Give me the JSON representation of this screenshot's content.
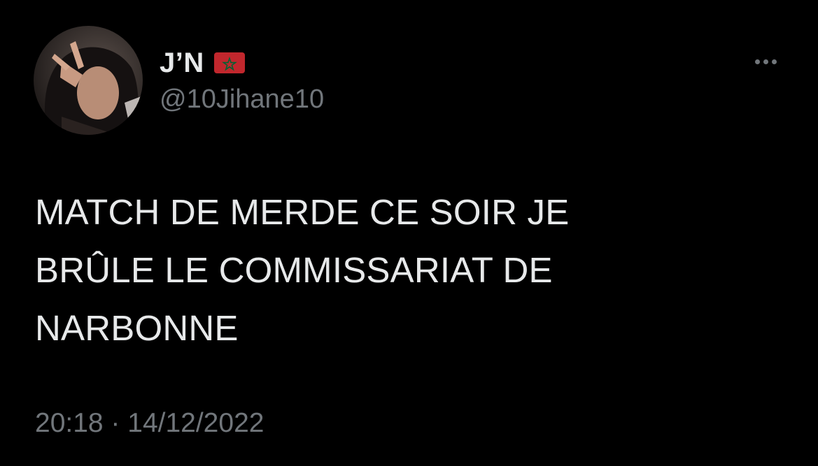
{
  "tweet": {
    "author": {
      "display_name": "J’N",
      "flag_icon": "morocco-flag-icon",
      "handle": "@10Jihane10"
    },
    "text": "MATCH DE MERDE CE SOIR JE\nBRÛLE LE COMMISSARIAT DE\nNARBONNE",
    "timestamp": "20:18 · 14/12/2022",
    "more_icon": "more-options-icon"
  },
  "colors": {
    "background": "#000000",
    "primary_text": "#e7e9ea",
    "secondary_text": "#71767b",
    "flag_red": "#c1272d",
    "flag_green": "#006233"
  }
}
